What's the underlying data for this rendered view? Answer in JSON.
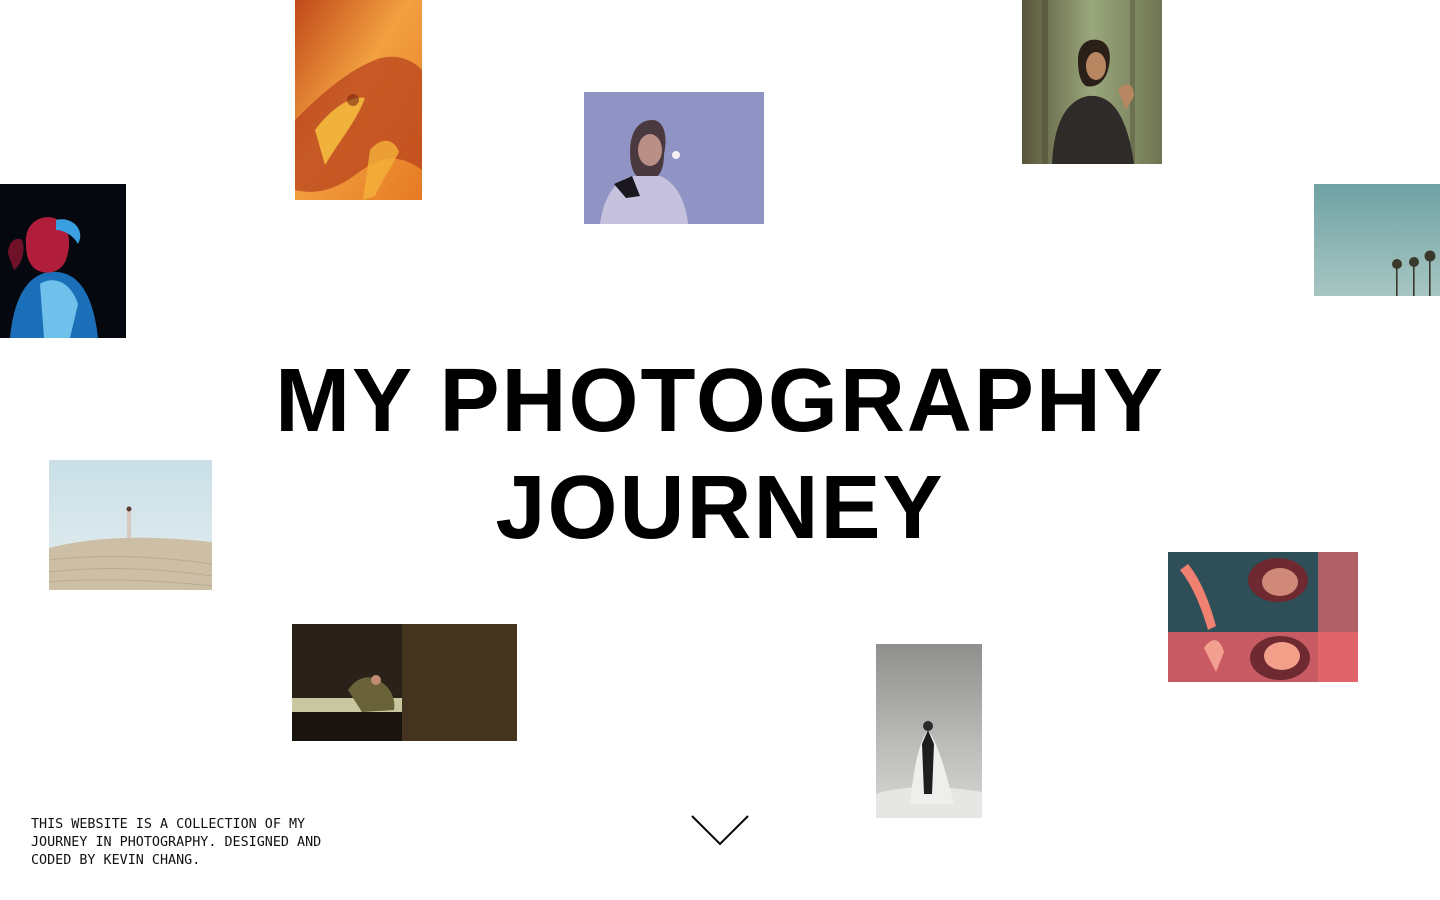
{
  "hero": {
    "title_line_1": "MY PHOTOGRAPHY",
    "title_line_2": "JOURNEY"
  },
  "footer": {
    "note": "THIS WEBSITE IS A COLLECTION OF MY JOURNEY IN PHOTOGRAPHY. DESIGNED AND CODED BY KEVIN CHANG."
  },
  "scroll": {
    "icon": "chevron-down-icon"
  },
  "colors": {
    "background": "#ffffff",
    "text": "#000000"
  }
}
